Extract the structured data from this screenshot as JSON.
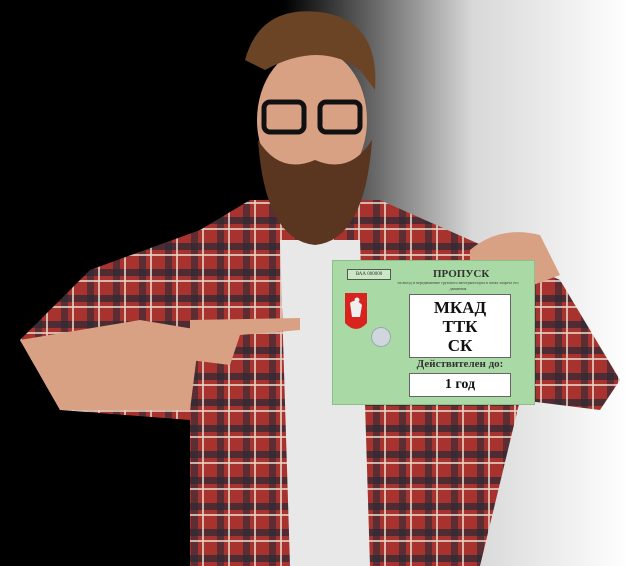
{
  "pass_card": {
    "serial": "ВАА 000000",
    "title": "ПРОПУСК",
    "subtitle": "на въезд и передвижение грузового автотранспорта в зонах запрета его движения",
    "zones": [
      "МКАД",
      "ТТК",
      "СК"
    ],
    "valid_label": "Действителен до:",
    "valid_value": "1 год",
    "color": "#a9d9a4"
  },
  "colors": {
    "shirt": "#a8332e",
    "tshirt": "#e8e8e8",
    "beard": "#5a3520",
    "skin": "#d9a183"
  }
}
